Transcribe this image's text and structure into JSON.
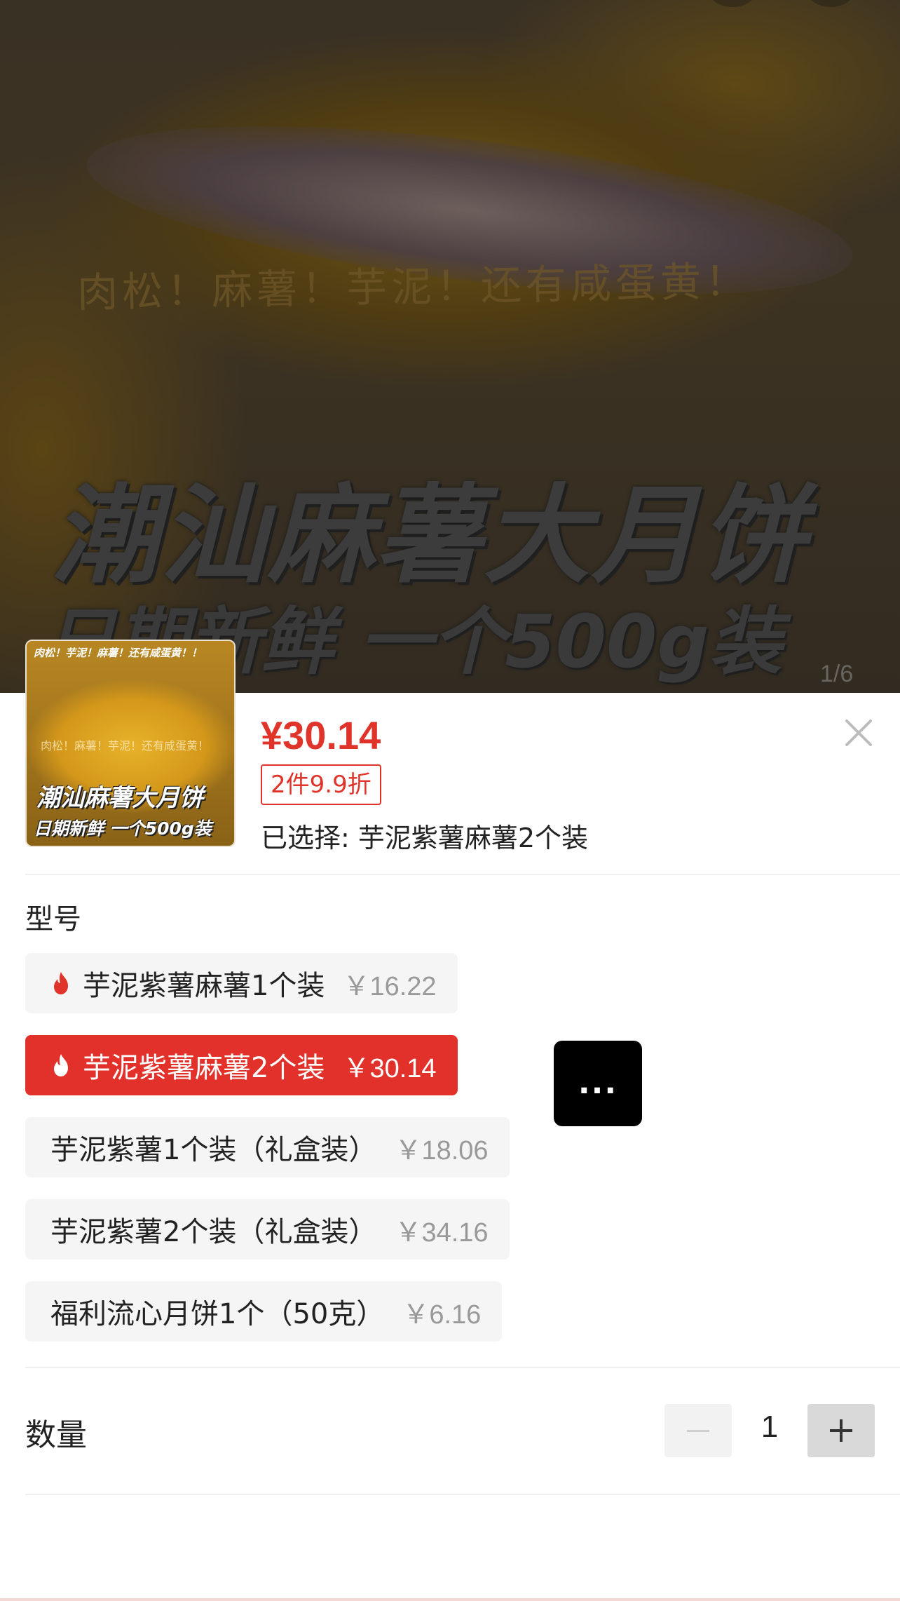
{
  "hero": {
    "tagline": "肉松！麻薯！芋泥！还有咸蛋黄！",
    "title": "潮汕麻薯大月饼",
    "subtitle": "日期新鲜  一个500g装",
    "image_counter": "1/6"
  },
  "thumbnail": {
    "top_text": "肉松！芋泥！麻薯！还有咸蛋黄！！",
    "tagline": "肉松！麻薯！芋泥！还有咸蛋黄！",
    "title": "潮汕麻薯大月饼",
    "subtitle": "日期新鲜  一个500g装"
  },
  "product": {
    "price": "¥30.14",
    "promo_badge": "2件9.9折",
    "selected_text": "已选择: 芋泥紫薯麻薯2个装"
  },
  "variant_section": {
    "label": "型号",
    "options": [
      {
        "name": "芋泥紫薯麻薯1个装",
        "price": "￥16.22",
        "hot": true,
        "selected": false
      },
      {
        "name": "芋泥紫薯麻薯2个装",
        "price": "￥30.14",
        "hot": true,
        "selected": true
      },
      {
        "name": "芋泥紫薯1个装（礼盒装）",
        "price": "￥18.06",
        "hot": false,
        "selected": false
      },
      {
        "name": "芋泥紫薯2个装（礼盒装）",
        "price": "￥34.16",
        "hot": false,
        "selected": false
      },
      {
        "name": "福利流心月饼1个（50克）",
        "price": "￥6.16",
        "hot": false,
        "selected": false
      }
    ]
  },
  "more_button": {
    "label": "..."
  },
  "quantity": {
    "label": "数量",
    "value": "1"
  },
  "colors": {
    "accent": "#e2312a",
    "price_red": "#e0332a",
    "option_bg": "#f5f5f5"
  },
  "icons": [
    "close-icon",
    "flame-icon",
    "minus-icon",
    "plus-icon",
    "more-icon"
  ]
}
